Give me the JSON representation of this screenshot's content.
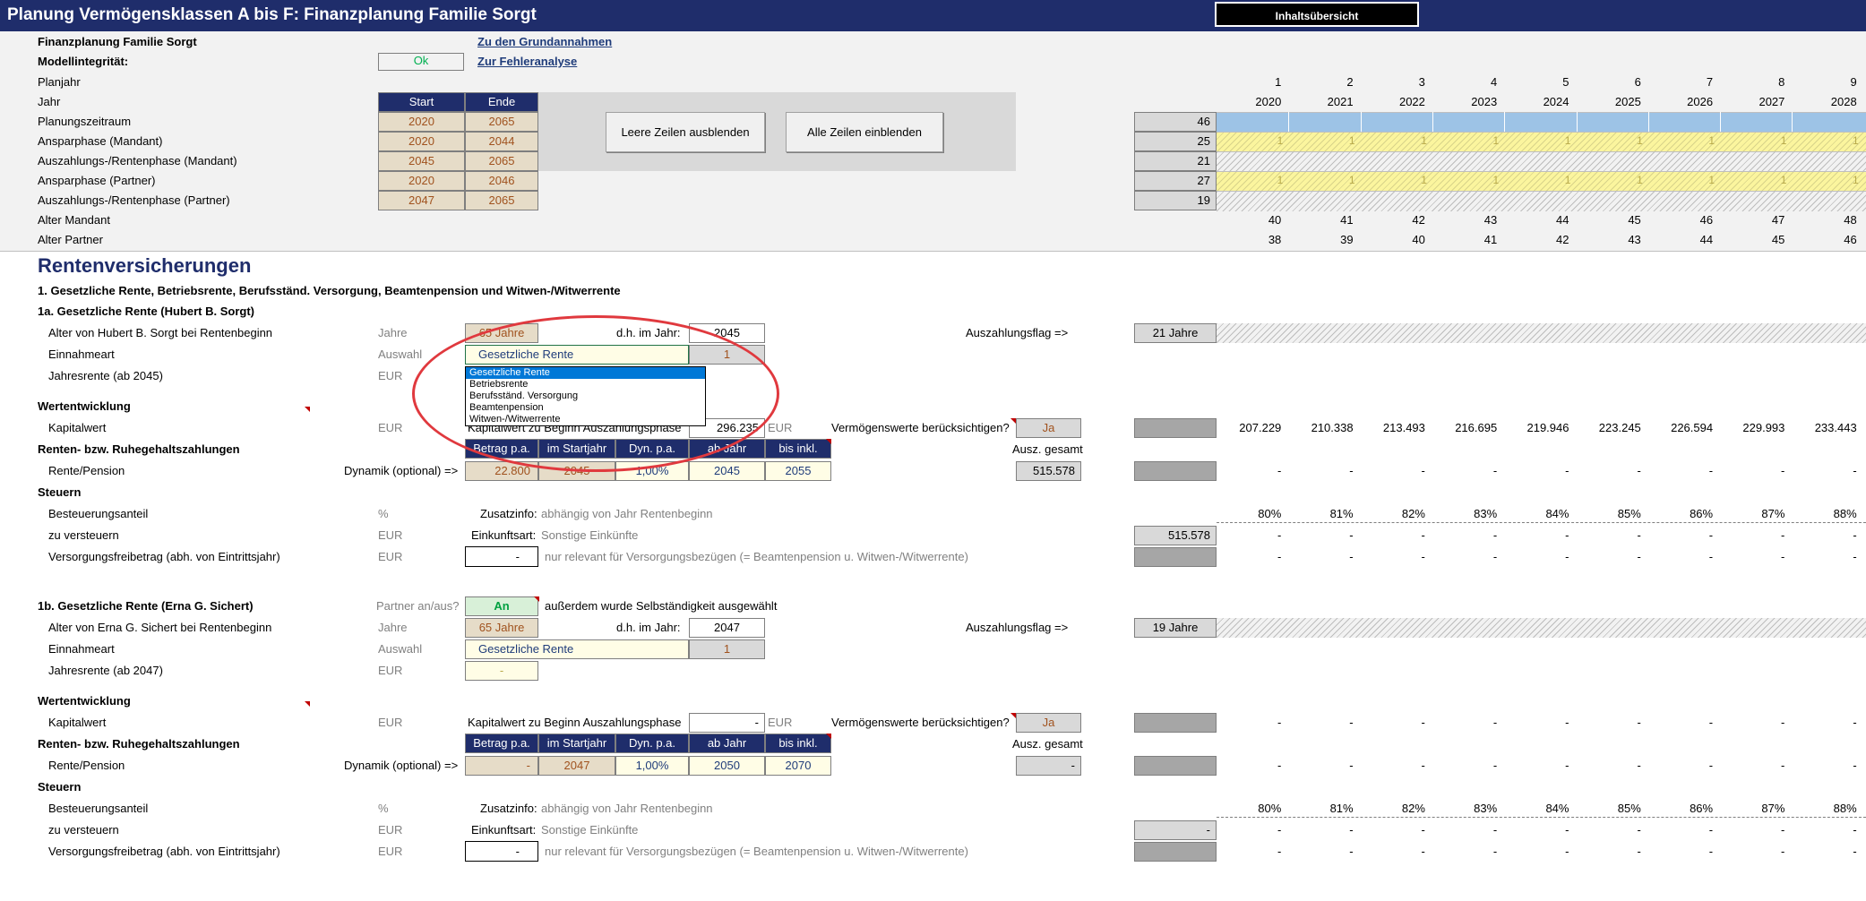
{
  "title": "Planung Vermögensklassen A bis F: Finanzplanung Familie Sorgt",
  "inhalt_button": "Inhaltsübersicht",
  "header": {
    "family": "Finanzplanung Familie Sorgt",
    "integrity_label": "Modellintegrität:",
    "integrity_value": "Ok",
    "link_grund": "Zu den Grundannahmen",
    "link_fehler": "Zur Fehleranalyse",
    "planjahr": "Planjahr",
    "jahr": "Jahr",
    "col_start": "Start",
    "col_ende": "Ende",
    "rows": [
      {
        "label": "Planungszeitraum",
        "start": "2020",
        "ende": "2065",
        "count": "46"
      },
      {
        "label": "Ansparphase (Mandant)",
        "start": "2020",
        "ende": "2044",
        "count": "25"
      },
      {
        "label": "Auszahlungs-/Rentenphase (Mandant)",
        "start": "2045",
        "ende": "2065",
        "count": "21"
      },
      {
        "label": "Ansparphase (Partner)",
        "start": "2020",
        "ende": "2046",
        "count": "27"
      },
      {
        "label": "Auszahlungs-/Rentenphase (Partner)",
        "start": "2047",
        "ende": "2065",
        "count": "19"
      }
    ],
    "alter_mandant": "Alter Mandant",
    "alter_partner": "Alter Partner",
    "btn_hide": "Leere Zeilen ausblenden",
    "btn_show": "Alle Zeilen einblenden",
    "planjahre": [
      "1",
      "2",
      "3",
      "4",
      "5",
      "6",
      "7",
      "8",
      "9"
    ],
    "jahre": [
      "2020",
      "2021",
      "2022",
      "2023",
      "2024",
      "2025",
      "2026",
      "2027",
      "2028"
    ],
    "alter_m": [
      "40",
      "41",
      "42",
      "43",
      "44",
      "45",
      "46",
      "47",
      "48"
    ],
    "alter_p": [
      "38",
      "39",
      "40",
      "41",
      "42",
      "43",
      "44",
      "45",
      "46"
    ],
    "flag_one": "1"
  },
  "section_title": "Rentenversicherungen",
  "sub1": "1. Gesetzliche Rente, Betriebsrente, Berufsständ. Versorgung, Beamtenpension und Witwen-/Witwerrente",
  "block_a": {
    "title": "1a. Gesetzliche Rente (Hubert B. Sorgt)",
    "alter_label": "Alter von Hubert B. Sorgt bei Rentenbeginn",
    "unit_jahre": "Jahre",
    "alter_value": "65 Jahre",
    "dh_label": "d.h. im Jahr:",
    "dh_value": "2045",
    "flag_label": "Auszahlungsflag =>",
    "flag_value": "21 Jahre",
    "einnahmeart": "Einnahmeart",
    "unit_auswahl": "Auswahl",
    "einnahme_value": "Gesetzliche Rente",
    "einnahme_num": "1",
    "jahresrente": "Jahresrente (ab 2045)",
    "unit_eur": "EUR",
    "dropdown": [
      "Gesetzliche Rente",
      "Betriebsrente",
      "Berufsständ. Versorgung",
      "Beamtenpension",
      "Witwen-/Witwerrente"
    ],
    "wertentwicklung": "Wertentwicklung",
    "kapitalwert": "Kapitalwert",
    "kap_begin_label": "Kapitalwert zu Beginn Auszahlungsphase",
    "kap_begin_value": "296.235",
    "verm_label": "Vermögenswerte berücksichtigen?",
    "verm_value": "Ja",
    "kap_row": [
      "207.229",
      "210.338",
      "213.493",
      "216.695",
      "219.946",
      "223.245",
      "226.594",
      "229.993",
      "233.443"
    ],
    "renten_title": "Renten- bzw. Ruhegehaltszahlungen",
    "cols": [
      "Betrag p.a.",
      "im Startjahr",
      "Dyn. p.a.",
      "ab Jahr",
      "bis inkl."
    ],
    "ausz_gesamt": "Ausz. gesamt",
    "rente_label": "Rente/Pension",
    "dynamik_label": "Dynamik (optional) =>",
    "rente_vals": [
      "22.800",
      "2045",
      "1,00%",
      "2045",
      "2055"
    ],
    "ausz_value": "515.578",
    "dash": "-",
    "steuern": "Steuern",
    "besteuerung": "Besteuerungsanteil",
    "unit_pct": "%",
    "zusatz_label": "Zusatzinfo:",
    "zusatz_value": "abhängig von Jahr Rentenbeginn",
    "pct_row": [
      "80%",
      "81%",
      "82%",
      "83%",
      "84%",
      "85%",
      "86%",
      "87%",
      "88%"
    ],
    "zu_versteuern": "zu versteuern",
    "einkunft_label": "Einkunftsart:",
    "einkunft_value": "Sonstige Einkünfte",
    "versteuern_value": "515.578",
    "vfb": "Versorgungsfreibetrag (abh. von Eintrittsjahr)",
    "vfb_note": "nur relevant für Versorgungsbezügen (= Beamtenpension u. Witwen-/Witwerrente)"
  },
  "block_b": {
    "title": "1b. Gesetzliche Rente (Erna G. Sichert)",
    "partner_label": "Partner an/aus?",
    "partner_value": "An",
    "partner_note": "außerdem wurde Selbständigkeit ausgewählt",
    "alter_label": "Alter von Erna G. Sichert bei Rentenbeginn",
    "alter_value": "65 Jahre",
    "dh_value": "2047",
    "flag_value": "19 Jahre",
    "einnahme_value": "Gesetzliche Rente",
    "einnahme_num": "1",
    "jahresrente": "Jahresrente (ab 2047)",
    "rente_vals": [
      "-",
      "2047",
      "1,00%",
      "2050",
      "2070"
    ],
    "ausz_value": "-",
    "kap_begin_value": "-",
    "verm_value": "Ja",
    "pct_row": [
      "80%",
      "81%",
      "82%",
      "83%",
      "84%",
      "85%",
      "86%",
      "87%",
      "88%"
    ]
  }
}
